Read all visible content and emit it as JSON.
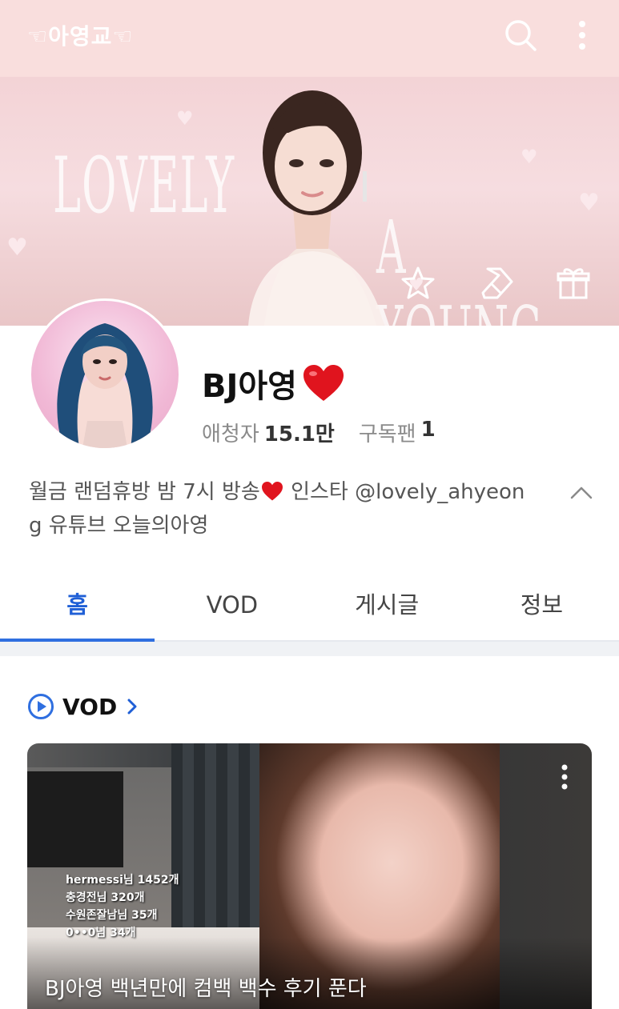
{
  "header": {
    "channel_name": "☜아영교☜",
    "icons": [
      "search-icon",
      "more-vertical-icon"
    ]
  },
  "banner": {
    "words": [
      "LOVELY",
      "A YOUNG"
    ],
    "actions": [
      "favorite-star-icon",
      "ticket-icon",
      "gift-icon"
    ]
  },
  "profile": {
    "name": "BJ아영",
    "stats": {
      "viewers_label": "애청자",
      "viewers_value": "15.1만",
      "fans_label": "구독팬",
      "fans_value": "1"
    },
    "bio_part1": "월금 랜덤휴방 밤 7시 방송",
    "bio_part2": " 인스타 @lovely_ahyeon",
    "bio_part3": "g 유튜브 오늘의아영"
  },
  "tabs": [
    {
      "label": "홈",
      "active": true
    },
    {
      "label": "VOD",
      "active": false
    },
    {
      "label": "게시글",
      "active": false
    },
    {
      "label": "정보",
      "active": false
    }
  ],
  "vod_section": {
    "title": "VOD",
    "card": {
      "title": "BJ아영 백년만에 컴백 백수 후기 푼다",
      "overlay_lines": [
        "hermessi님 1452개",
        "충경전님 320개",
        "수원존잘남님 35개",
        "0••0님 34개"
      ]
    }
  },
  "colors": {
    "header_bg": "#f9dedd",
    "accent": "#2f6fe0",
    "heart": "#e0141e"
  }
}
